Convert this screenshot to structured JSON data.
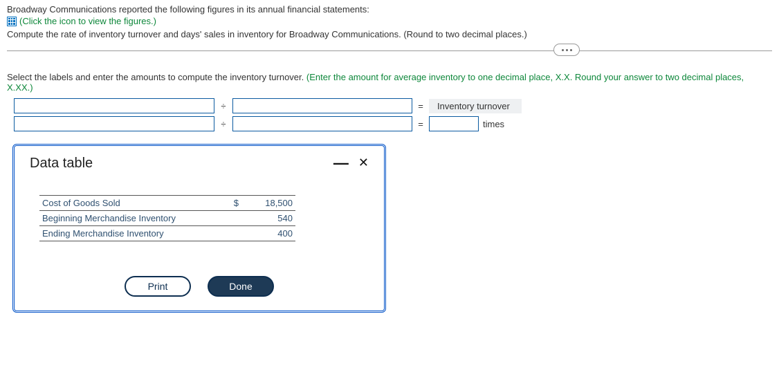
{
  "intro": {
    "line1": "Broadway Communications reported the following figures in its annual financial statements:",
    "click_icon_text": "(Click the icon to view the figures.)",
    "compute_text": "Compute the rate of inventory turnover and days' sales in inventory for Broadway Communications. (Round to two decimal places.)"
  },
  "instruction": {
    "main": "Select the labels and enter the amounts to compute the inventory turnover. ",
    "hint": "(Enter the amount for average inventory to one decimal place, X.X. Round your answer to two decimal places, X.XX.)"
  },
  "formula": {
    "divide": "÷",
    "equals": "=",
    "result_label": "Inventory turnover",
    "suffix": "times"
  },
  "dialog": {
    "title": "Data table",
    "rows": [
      {
        "label": "Cost of Goods Sold",
        "currency": "$",
        "value": "18,500"
      },
      {
        "label": "Beginning Merchandise Inventory",
        "currency": "",
        "value": "540"
      },
      {
        "label": "Ending Merchandise Inventory",
        "currency": "",
        "value": "400"
      }
    ],
    "print": "Print",
    "done": "Done"
  }
}
